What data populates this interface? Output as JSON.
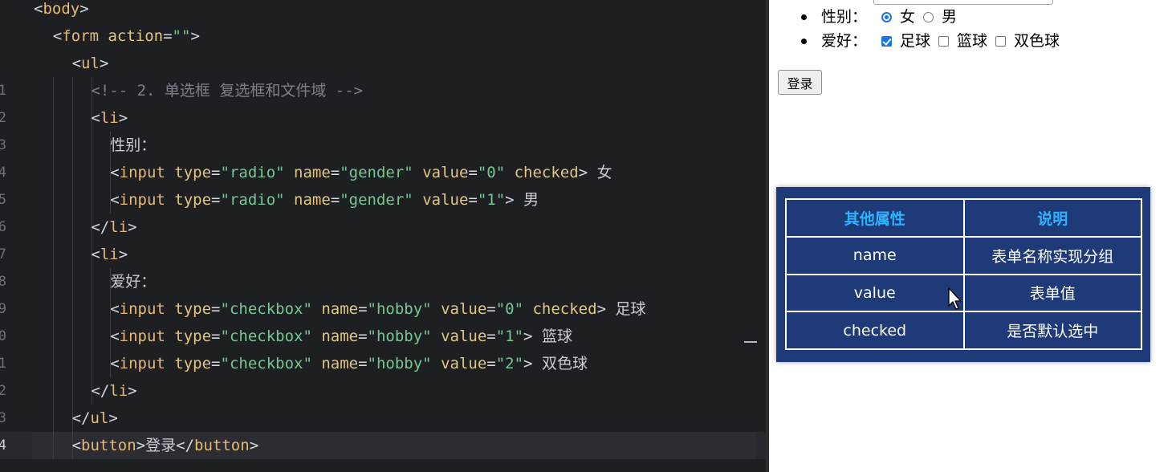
{
  "editor": {
    "lines": [
      {
        "num": "",
        "tokens": [
          {
            "t": "<",
            "c": "punc"
          },
          {
            "t": "body",
            "c": "tag"
          },
          {
            "t": ">",
            "c": "punc"
          }
        ]
      },
      {
        "num": "",
        "tokens": [
          {
            "t": "<",
            "c": "punc"
          },
          {
            "t": "form",
            "c": "tag"
          },
          {
            "t": " action",
            "c": "attr"
          },
          {
            "t": "=",
            "c": "punc"
          },
          {
            "t": "\"\"",
            "c": "str"
          },
          {
            "t": ">",
            "c": "punc"
          }
        ]
      },
      {
        "num": "",
        "tokens": [
          {
            "t": "<",
            "c": "punc"
          },
          {
            "t": "ul",
            "c": "tag"
          },
          {
            "t": ">",
            "c": "punc"
          }
        ]
      },
      {
        "num": "1",
        "tokens": [
          {
            "t": "<!-- 2. 单选框 复选框和文件域 -->",
            "c": "com"
          }
        ]
      },
      {
        "num": "2",
        "tokens": [
          {
            "t": "<",
            "c": "punc"
          },
          {
            "t": "li",
            "c": "tag"
          },
          {
            "t": ">",
            "c": "punc"
          }
        ]
      },
      {
        "num": "3",
        "tokens": [
          {
            "t": "性别：",
            "c": "txt"
          }
        ]
      },
      {
        "num": "4",
        "tokens": [
          {
            "t": "<",
            "c": "punc"
          },
          {
            "t": "input",
            "c": "tag"
          },
          {
            "t": " type",
            "c": "attr"
          },
          {
            "t": "=",
            "c": "punc"
          },
          {
            "t": "\"radio\"",
            "c": "str"
          },
          {
            "t": " name",
            "c": "attr"
          },
          {
            "t": "=",
            "c": "punc"
          },
          {
            "t": "\"gender\"",
            "c": "str"
          },
          {
            "t": " value",
            "c": "attr"
          },
          {
            "t": "=",
            "c": "punc"
          },
          {
            "t": "\"0\"",
            "c": "str"
          },
          {
            "t": " checked",
            "c": "attr"
          },
          {
            "t": ">",
            "c": "punc"
          },
          {
            "t": " 女",
            "c": "txt"
          }
        ]
      },
      {
        "num": "5",
        "tokens": [
          {
            "t": "<",
            "c": "punc"
          },
          {
            "t": "input",
            "c": "tag"
          },
          {
            "t": " type",
            "c": "attr"
          },
          {
            "t": "=",
            "c": "punc"
          },
          {
            "t": "\"radio\"",
            "c": "str"
          },
          {
            "t": " name",
            "c": "attr"
          },
          {
            "t": "=",
            "c": "punc"
          },
          {
            "t": "\"gender\"",
            "c": "str"
          },
          {
            "t": " value",
            "c": "attr"
          },
          {
            "t": "=",
            "c": "punc"
          },
          {
            "t": "\"1\"",
            "c": "str"
          },
          {
            "t": ">",
            "c": "punc"
          },
          {
            "t": " 男",
            "c": "txt"
          }
        ]
      },
      {
        "num": "6",
        "tokens": [
          {
            "t": "</",
            "c": "punc"
          },
          {
            "t": "li",
            "c": "tag"
          },
          {
            "t": ">",
            "c": "punc"
          }
        ]
      },
      {
        "num": "7",
        "tokens": [
          {
            "t": "<",
            "c": "punc"
          },
          {
            "t": "li",
            "c": "tag"
          },
          {
            "t": ">",
            "c": "punc"
          }
        ]
      },
      {
        "num": "8",
        "tokens": [
          {
            "t": "爱好：",
            "c": "txt"
          }
        ]
      },
      {
        "num": "9",
        "tokens": [
          {
            "t": "<",
            "c": "punc"
          },
          {
            "t": "input",
            "c": "tag"
          },
          {
            "t": " type",
            "c": "attr"
          },
          {
            "t": "=",
            "c": "punc"
          },
          {
            "t": "\"checkbox\"",
            "c": "str"
          },
          {
            "t": " name",
            "c": "attr"
          },
          {
            "t": "=",
            "c": "punc"
          },
          {
            "t": "\"hobby\"",
            "c": "str"
          },
          {
            "t": " value",
            "c": "attr"
          },
          {
            "t": "=",
            "c": "punc"
          },
          {
            "t": "\"0\"",
            "c": "str"
          },
          {
            "t": " checked",
            "c": "attr"
          },
          {
            "t": ">",
            "c": "punc"
          },
          {
            "t": " 足球",
            "c": "txt"
          }
        ]
      },
      {
        "num": "0",
        "tokens": [
          {
            "t": "<",
            "c": "punc"
          },
          {
            "t": "input",
            "c": "tag"
          },
          {
            "t": " type",
            "c": "attr"
          },
          {
            "t": "=",
            "c": "punc"
          },
          {
            "t": "\"checkbox\"",
            "c": "str"
          },
          {
            "t": " name",
            "c": "attr"
          },
          {
            "t": "=",
            "c": "punc"
          },
          {
            "t": "\"hobby\"",
            "c": "str"
          },
          {
            "t": " value",
            "c": "attr"
          },
          {
            "t": "=",
            "c": "punc"
          },
          {
            "t": "\"1\"",
            "c": "str"
          },
          {
            "t": ">",
            "c": "punc"
          },
          {
            "t": " 篮球",
            "c": "txt"
          }
        ]
      },
      {
        "num": "1",
        "tokens": [
          {
            "t": "<",
            "c": "punc"
          },
          {
            "t": "input",
            "c": "tag"
          },
          {
            "t": " type",
            "c": "attr"
          },
          {
            "t": "=",
            "c": "punc"
          },
          {
            "t": "\"checkbox\"",
            "c": "str"
          },
          {
            "t": " name",
            "c": "attr"
          },
          {
            "t": "=",
            "c": "punc"
          },
          {
            "t": "\"hobby\"",
            "c": "str"
          },
          {
            "t": " value",
            "c": "attr"
          },
          {
            "t": "=",
            "c": "punc"
          },
          {
            "t": "\"2\"",
            "c": "str"
          },
          {
            "t": ">",
            "c": "punc"
          },
          {
            "t": " 双色球",
            "c": "txt"
          }
        ]
      },
      {
        "num": "2",
        "tokens": [
          {
            "t": "</",
            "c": "punc"
          },
          {
            "t": "li",
            "c": "tag"
          },
          {
            "t": ">",
            "c": "punc"
          }
        ]
      },
      {
        "num": "3",
        "tokens": [
          {
            "t": "</",
            "c": "punc"
          },
          {
            "t": "ul",
            "c": "tag"
          },
          {
            "t": ">",
            "c": "punc"
          }
        ]
      },
      {
        "num": "4",
        "current": true,
        "tokens": [
          {
            "t": "<",
            "c": "punc"
          },
          {
            "t": "button",
            "c": "tag"
          },
          {
            "t": ">",
            "c": "punc"
          },
          {
            "t": "登录",
            "c": "txt"
          },
          {
            "t": "</",
            "c": "punc"
          },
          {
            "t": "button",
            "c": "tag"
          },
          {
            "t": ">",
            "c": "punc"
          }
        ]
      }
    ]
  },
  "preview": {
    "gender": {
      "label": "性别：",
      "options": [
        {
          "label": "女",
          "checked": true
        },
        {
          "label": "男",
          "checked": false
        }
      ]
    },
    "hobby": {
      "label": "爱好：",
      "options": [
        {
          "label": "足球",
          "checked": true
        },
        {
          "label": "篮球",
          "checked": false
        },
        {
          "label": "双色球",
          "checked": false
        }
      ]
    },
    "login_button": "登录"
  },
  "attr_table": {
    "headers": [
      "其他属性",
      "说明"
    ],
    "rows": [
      [
        "name",
        "表单名称实现分组"
      ],
      [
        "value",
        "表单值"
      ],
      [
        "checked",
        "是否默认选中"
      ]
    ]
  },
  "colors": {
    "panel_bg": "#1f3a78",
    "header_text": "#2fb3ff",
    "accent_blue": "#1a73e8"
  }
}
